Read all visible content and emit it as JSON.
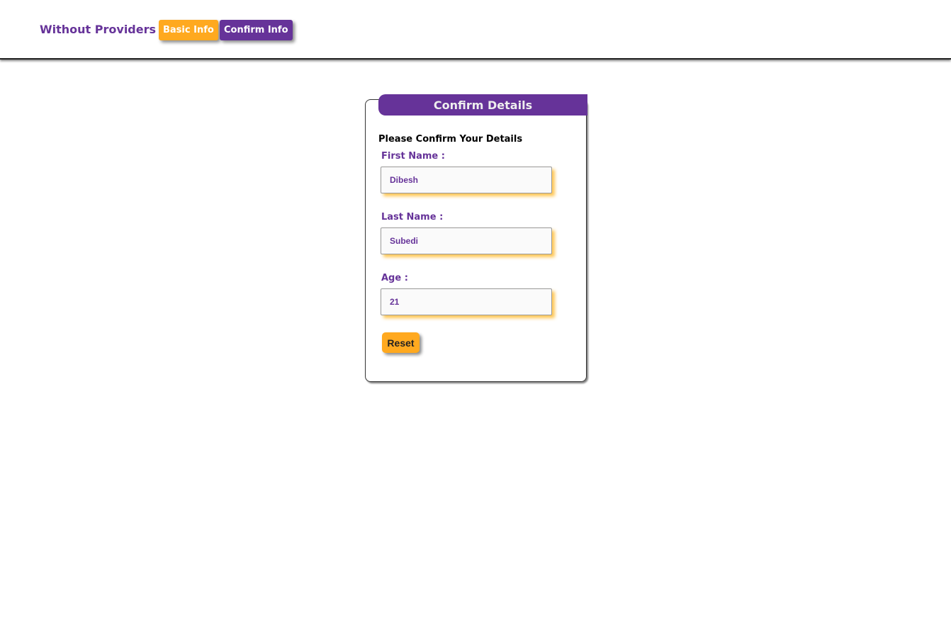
{
  "nav": {
    "brand": "Without Providers",
    "links": [
      {
        "label": "Basic Info"
      },
      {
        "label": "Confirm Info"
      }
    ]
  },
  "colors": {
    "accent": "#663399",
    "highlight": "#ffa91f"
  },
  "card": {
    "title": "Confirm Details",
    "subtitle": "Please Confirm Your Details",
    "fields": [
      {
        "label": "First Name :",
        "value": "Dibesh"
      },
      {
        "label": "Last Name :",
        "value": "Subedi"
      },
      {
        "label": "Age :",
        "value": "21"
      }
    ],
    "reset_label": "Reset"
  }
}
